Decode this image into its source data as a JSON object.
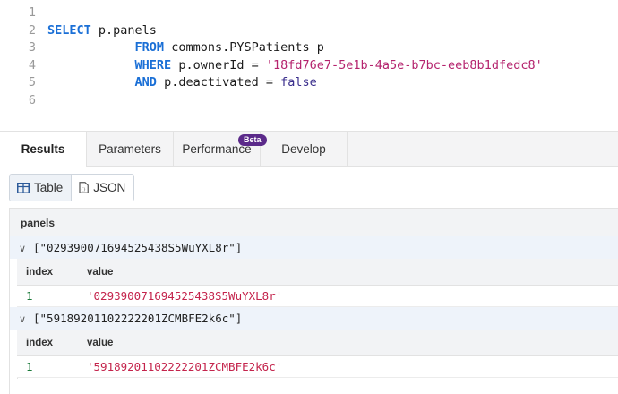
{
  "editor": {
    "lines": [
      {
        "num": "1",
        "parts": []
      },
      {
        "num": "2",
        "parts": [
          {
            "t": "SELECT",
            "c": "kw"
          },
          {
            "t": " p.panels",
            "c": ""
          }
        ]
      },
      {
        "num": "3",
        "parts": [
          {
            "t": "            ",
            "c": ""
          },
          {
            "t": "FROM",
            "c": "kw"
          },
          {
            "t": " commons.PYSPatients p",
            "c": ""
          }
        ]
      },
      {
        "num": "4",
        "parts": [
          {
            "t": "            ",
            "c": ""
          },
          {
            "t": "WHERE",
            "c": "kw"
          },
          {
            "t": " p.ownerId = ",
            "c": ""
          },
          {
            "t": "'18fd76e7-5e1b-4a5e-b7bc-eeb8b1dfedc8'",
            "c": "str"
          }
        ]
      },
      {
        "num": "5",
        "parts": [
          {
            "t": "            ",
            "c": ""
          },
          {
            "t": "AND",
            "c": "kw"
          },
          {
            "t": " p.deactivated = ",
            "c": ""
          },
          {
            "t": "false",
            "c": "bool"
          }
        ]
      },
      {
        "num": "6",
        "parts": []
      }
    ]
  },
  "tabs": [
    {
      "label": "Results",
      "active": true
    },
    {
      "label": "Parameters",
      "active": false
    },
    {
      "label": "Performance",
      "active": false,
      "badge": "Beta"
    },
    {
      "label": "Develop",
      "active": false
    }
  ],
  "view_toggle": {
    "table_label": "Table",
    "json_label": "JSON"
  },
  "results": {
    "column": "panels",
    "sub_columns": {
      "index": "index",
      "value": "value"
    },
    "groups": [
      {
        "label": "[\"029390071694525438S5WuYXL8r\"]",
        "rows": [
          {
            "index": "1",
            "value": "'029390071694525438S5WuYXL8r'"
          }
        ]
      },
      {
        "label": "[\"59189201102222201ZCMBFE2k6c\"]",
        "rows": [
          {
            "index": "1",
            "value": "'59189201102222201ZCMBFE2k6c'"
          }
        ]
      }
    ]
  }
}
